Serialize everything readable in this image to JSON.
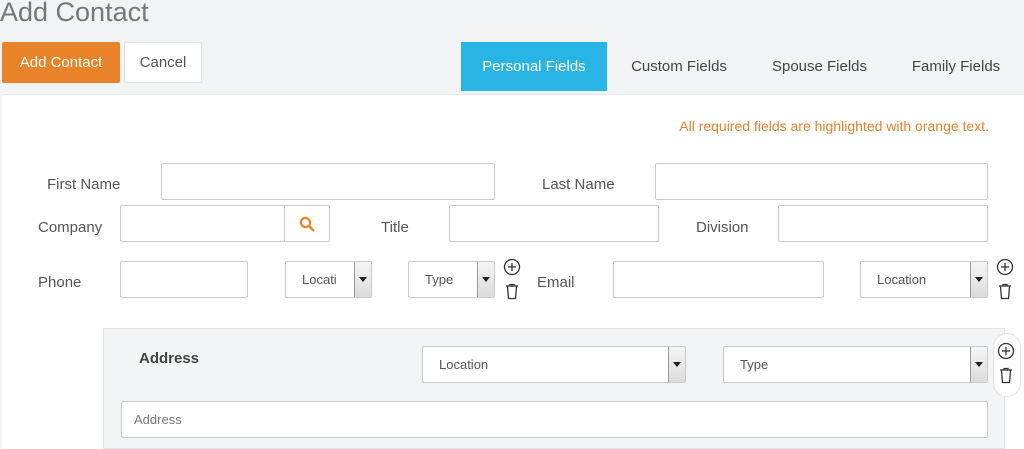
{
  "page": {
    "title": "Add Contact"
  },
  "toolbar": {
    "add_label": "Add Contact",
    "cancel_label": "Cancel"
  },
  "tabs": [
    {
      "label": "Personal Fields",
      "active": true
    },
    {
      "label": "Custom Fields",
      "active": false
    },
    {
      "label": "Spouse Fields",
      "active": false
    },
    {
      "label": "Family Fields",
      "active": false
    }
  ],
  "form": {
    "required_note": "All required fields are highlighted with orange text.",
    "first_name_label": "First Name",
    "last_name_label": "Last Name",
    "company_label": "Company",
    "title_label": "Title",
    "division_label": "Division",
    "phone_label": "Phone",
    "email_label": "Email",
    "phone_location": "Locati",
    "phone_type": "Type",
    "email_location": "Location",
    "address_label": "Address",
    "address_location": "Location",
    "address_type": "Type",
    "address_placeholder": "Address"
  },
  "icons": {
    "search": "search-icon",
    "add": "plus-circle-icon",
    "delete": "trash-icon"
  },
  "colors": {
    "accent": "#e8832a",
    "tab_active": "#29b4e6"
  }
}
